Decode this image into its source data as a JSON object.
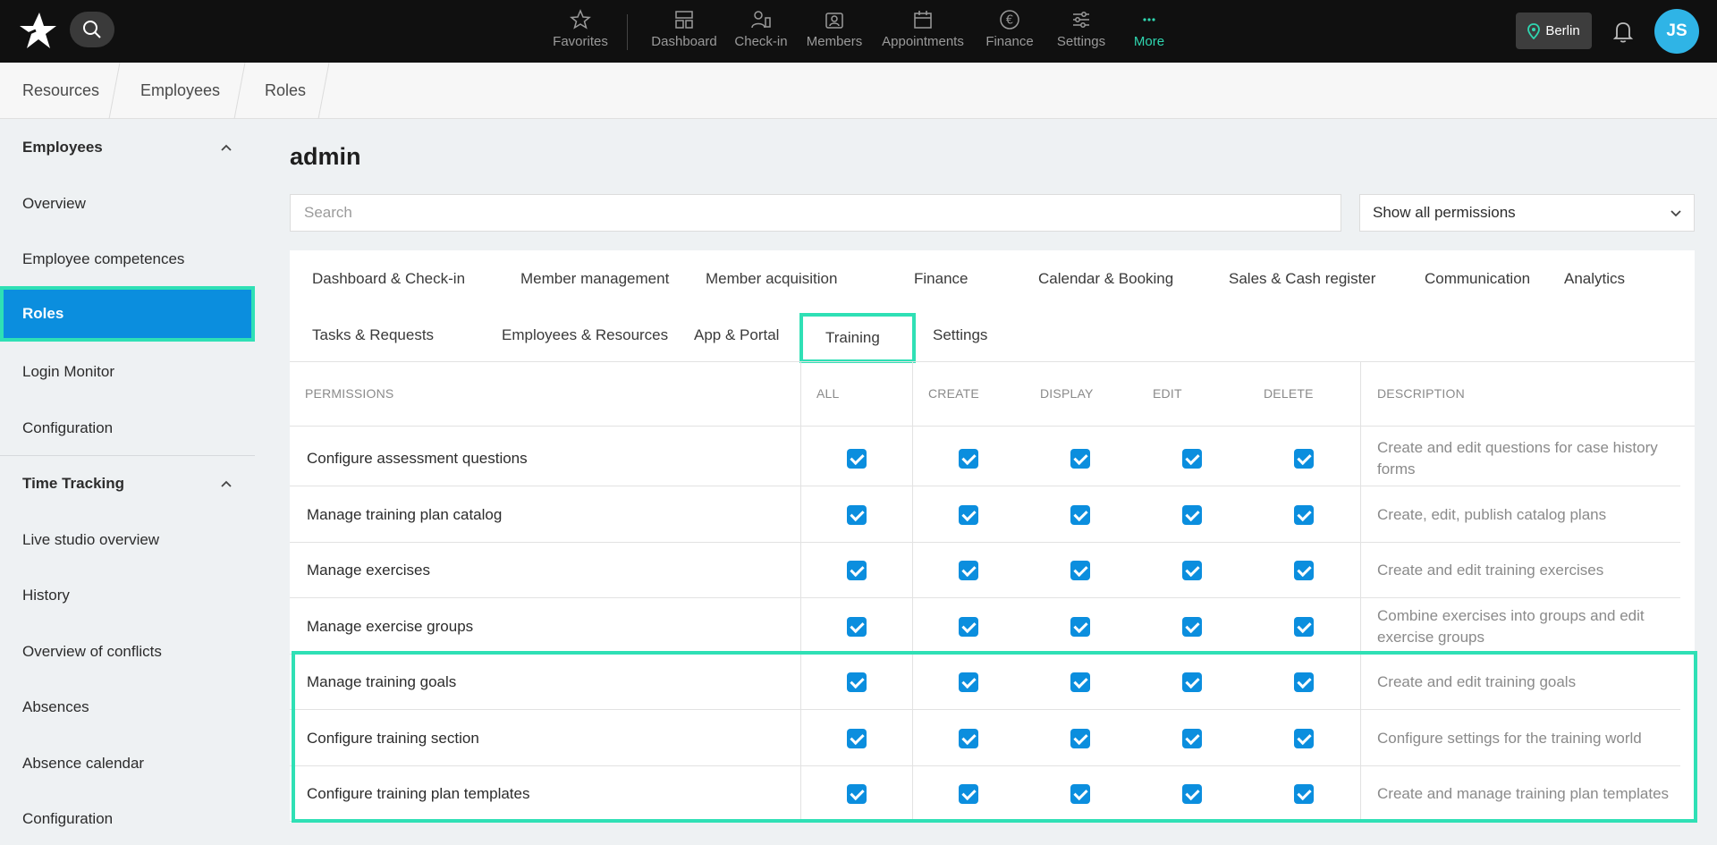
{
  "topbar": {
    "nav": [
      {
        "label": "Favorites",
        "icon": "star-icon"
      },
      {
        "label": "Dashboard",
        "icon": "dashboard-icon"
      },
      {
        "label": "Check-in",
        "icon": "check-in-icon"
      },
      {
        "label": "Members",
        "icon": "members-icon"
      },
      {
        "label": "Appointments",
        "icon": "calendar-icon"
      },
      {
        "label": "Finance",
        "icon": "euro-icon"
      },
      {
        "label": "Settings",
        "icon": "sliders-icon"
      },
      {
        "label": "More",
        "icon": "more-dots-icon"
      }
    ],
    "location": "Berlin",
    "avatar_initials": "JS",
    "accent_color": "#2fd6b0"
  },
  "breadcrumb": [
    "Resources",
    "Employees",
    "Roles"
  ],
  "sidebar": {
    "sections": [
      {
        "title": "Employees",
        "items": [
          "Overview",
          "Employee competences",
          "Roles",
          "Login Monitor",
          "Configuration"
        ]
      },
      {
        "title": "Time Tracking",
        "items": [
          "Live studio overview",
          "History",
          "Overview of conflicts",
          "Absences",
          "Absence calendar",
          "Configuration"
        ]
      }
    ],
    "active_item": "Roles",
    "active_color": "#0b8ede"
  },
  "main": {
    "title": "admin",
    "search_placeholder": "Search",
    "filter_value": "Show all permissions",
    "tabs_row1": [
      "Dashboard & Check-in",
      "Member management",
      "Member acquisition",
      "Finance",
      "Calendar & Booking",
      "Sales & Cash register",
      "Communication",
      "Analytics"
    ],
    "tabs_row2": [
      "Tasks & Requests",
      "Employees & Resources",
      "App & Portal",
      "Training",
      "Settings"
    ],
    "active_tab": "Training",
    "columns": {
      "permissions": "PERMISSIONS",
      "all": "ALL",
      "create": "CREATE",
      "display": "DISPLAY",
      "edit": "EDIT",
      "delete": "DELETE",
      "description": "DESCRIPTION"
    },
    "rows": [
      {
        "name": "Configure assessment questions",
        "description": "Create and edit questions for case history forms",
        "checked": [
          true,
          true,
          true,
          true,
          true
        ]
      },
      {
        "name": "Manage training plan catalog",
        "description": "Create, edit, publish catalog plans",
        "checked": [
          true,
          true,
          true,
          true,
          true
        ]
      },
      {
        "name": "Manage exercises",
        "description": "Create and edit training exercises",
        "checked": [
          true,
          true,
          true,
          true,
          true
        ]
      },
      {
        "name": "Manage exercise groups",
        "description": "Combine exercises into groups and edit exercise groups",
        "checked": [
          true,
          true,
          true,
          true,
          true
        ]
      },
      {
        "name": "Manage training goals",
        "description": "Create and edit training goals",
        "checked": [
          true,
          true,
          true,
          true,
          true
        ]
      },
      {
        "name": "Configure training section",
        "description": "Configure settings for the training world",
        "checked": [
          true,
          true,
          true,
          true,
          true
        ]
      },
      {
        "name": "Configure training plan templates",
        "description": "Create and manage training plan templates",
        "checked": [
          true,
          true,
          true,
          true,
          true
        ]
      }
    ],
    "highlight_color": "#2fe0b5"
  }
}
